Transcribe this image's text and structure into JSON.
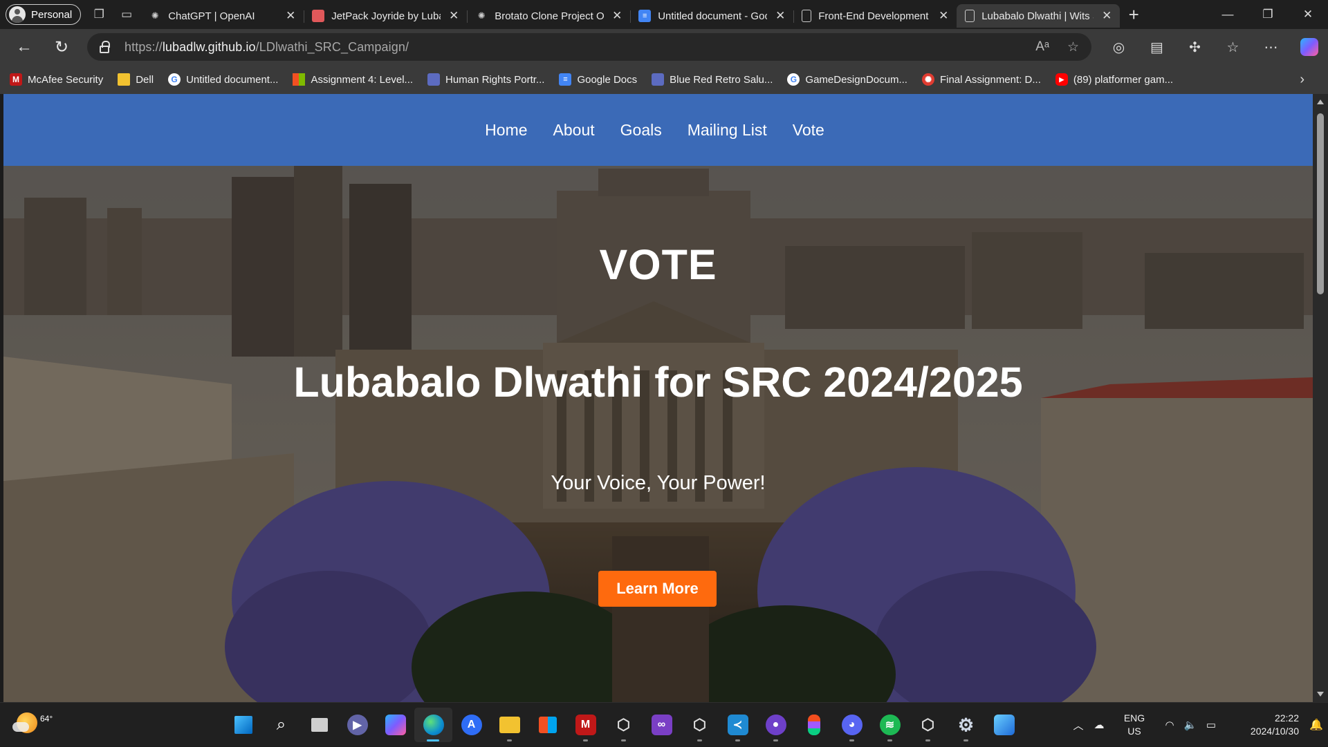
{
  "browser": {
    "profile_label": "Personal",
    "tabs": [
      {
        "title": "ChatGPT | OpenAI",
        "icon": "openai-icon",
        "color": "#3a3a3a"
      },
      {
        "title": "JetPack Joyride by Lubalo",
        "icon": "jetpack-joyride-icon",
        "color": "#e0585a"
      },
      {
        "title": "Brotato Clone Project Overview",
        "icon": "openai-icon",
        "color": "#3a3a3a"
      },
      {
        "title": "Untitled document - Google Docs",
        "icon": "google-docs-icon",
        "color": "#4285f4"
      },
      {
        "title": "Front-End Development",
        "icon": "document-icon",
        "color": "#3a3a3a"
      },
      {
        "title": "Lubabalo Dlwathi | Wits SRC",
        "icon": "document-icon",
        "color": "#3a3a3a",
        "active": true
      }
    ],
    "url_scheme": "https://",
    "url_host": "lubadlw.github.io",
    "url_path": "/LDlwathi_SRC_Campaign/",
    "bookmarks": [
      {
        "label": "McAfee Security",
        "icon": "mcafee-icon",
        "color": "#c01818"
      },
      {
        "label": "Dell",
        "icon": "folder-icon",
        "color": "#f2c230"
      },
      {
        "label": "Untitled document...",
        "icon": "google-icon",
        "color": "#ffffff"
      },
      {
        "label": "Assignment 4: Level...",
        "icon": "microsoft-icon",
        "color": "#f25022"
      },
      {
        "label": "Human Rights Portr...",
        "icon": "slides-icon",
        "color": "#5c6bc0"
      },
      {
        "label": "Google Docs",
        "icon": "google-docs-icon",
        "color": "#4285f4"
      },
      {
        "label": "Blue Red Retro Salu...",
        "icon": "slides-icon",
        "color": "#5c6bc0"
      },
      {
        "label": "GameDesignDocum...",
        "icon": "google-icon",
        "color": "#ffffff"
      },
      {
        "label": "Final Assignment: D...",
        "icon": "canvas-icon",
        "color": "#e03c31"
      },
      {
        "label": "(89) platformer gam...",
        "icon": "youtube-icon",
        "color": "#ff0000"
      }
    ]
  },
  "site": {
    "nav": [
      "Home",
      "About",
      "Goals",
      "Mailing List",
      "Vote"
    ],
    "nav_color": "#3b6ab7",
    "hero_kicker": "VOTE",
    "hero_title": "Lubabalo Dlwathi for SRC 2024/2025",
    "hero_subtitle": "Your Voice, Your Power!",
    "cta_label": "Learn More",
    "cta_color": "#fe6a0e"
  },
  "taskbar": {
    "weather_temp": "64°",
    "apps": [
      {
        "name": "start-icon",
        "color": "#0078d4"
      },
      {
        "name": "search-icon",
        "color": "transparent"
      },
      {
        "name": "task-view-icon",
        "color": "transparent"
      },
      {
        "name": "teams-icon",
        "color": "#6264a7"
      },
      {
        "name": "copilot-icon",
        "color": "#8a5cff"
      },
      {
        "name": "edge-icon",
        "color": "#0c8fcf",
        "active": true
      },
      {
        "name": "app-store-icon",
        "color": "#2f6df6"
      },
      {
        "name": "file-explorer-icon",
        "color": "#f2c230"
      },
      {
        "name": "microsoft-store-icon",
        "color": "#e8e8e8"
      },
      {
        "name": "mcafee-icon",
        "color": "#c01818"
      },
      {
        "name": "unity-icon",
        "color": "#3a3a3a"
      },
      {
        "name": "visual-studio-icon",
        "color": "#7a3fc5"
      },
      {
        "name": "unity-hub-icon",
        "color": "#3a3a3a"
      },
      {
        "name": "vscode-icon",
        "color": "#1f8ad2"
      },
      {
        "name": "github-icon",
        "color": "#6e40c9"
      },
      {
        "name": "figma-icon",
        "color": "#1e1e1e"
      },
      {
        "name": "discord-icon",
        "color": "#5865f2"
      },
      {
        "name": "spotify-icon",
        "color": "#1db954"
      },
      {
        "name": "unity-icon",
        "color": "#3a3a3a"
      },
      {
        "name": "settings-icon",
        "color": "#4a4a4a"
      },
      {
        "name": "photos-icon",
        "color": "#2a8ae0"
      }
    ],
    "lang_line1": "ENG",
    "lang_line2": "US",
    "time": "22:22",
    "date": "2024/10/30"
  }
}
